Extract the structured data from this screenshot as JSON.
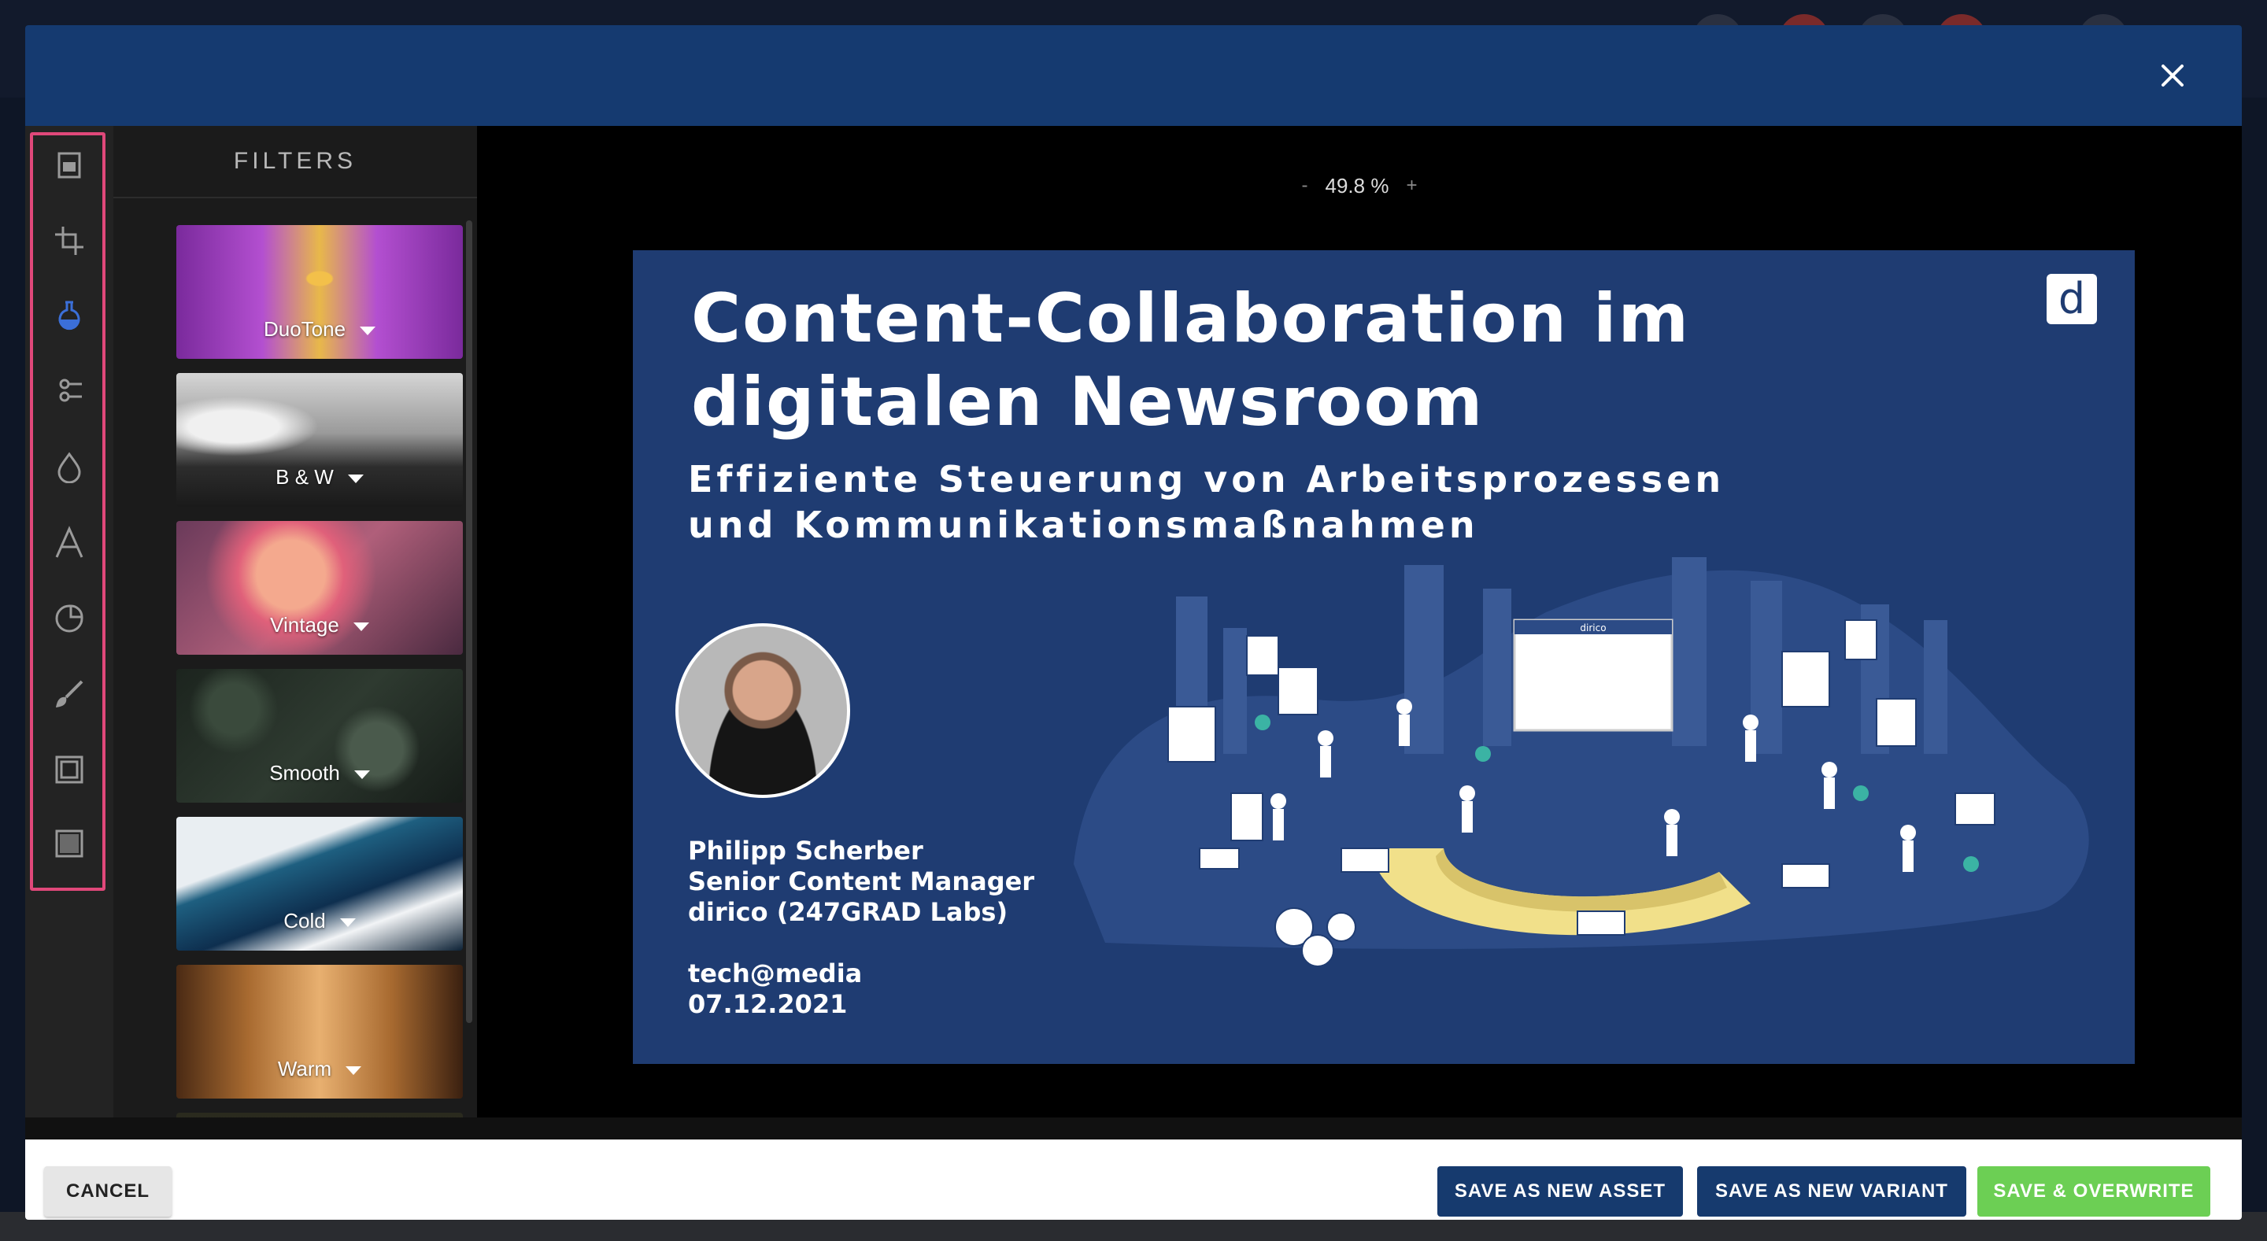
{
  "filters_panel": {
    "title": "FILTERS",
    "items": [
      {
        "label": "DuoTone"
      },
      {
        "label": "B & W"
      },
      {
        "label": "Vintage"
      },
      {
        "label": "Smooth"
      },
      {
        "label": "Cold"
      },
      {
        "label": "Warm"
      }
    ]
  },
  "tools": [
    "image-icon",
    "crop-icon",
    "filter-flask-icon",
    "adjust-icon",
    "drop-icon",
    "text-icon",
    "sticker-icon",
    "brush-icon",
    "frame-icon",
    "overlay-icon"
  ],
  "canvas": {
    "zoom_out": "-",
    "zoom_level": "49.8 %",
    "zoom_in": "+"
  },
  "slide": {
    "title_line1": "Content-Collaboration im",
    "title_line2": "digitalen Newsroom",
    "subtitle_line1": "Effiziente Steuerung von Arbeitsprozessen",
    "subtitle_line2": "und Kommunikationsmaßnahmen",
    "logo": "d",
    "speaker_name": "Philipp Scherber",
    "speaker_role": "Senior Content Manager",
    "speaker_company": "dirico (247GRAD Labs)",
    "event_name": "tech@media",
    "event_date": "07.12.2021",
    "illustration_screen_label": "dirico"
  },
  "footer": {
    "cancel": "CANCEL",
    "save_new_asset": "SAVE AS NEW ASSET",
    "save_new_variant": "SAVE AS NEW VARIANT",
    "save_overwrite": "SAVE & OVERWRITE"
  },
  "colors": {
    "header": "#153a70",
    "primary_button": "#163a6e",
    "success_button": "#6ccf54",
    "tool_highlight": "#e0487a",
    "active_tool": "#3b6fd8"
  }
}
